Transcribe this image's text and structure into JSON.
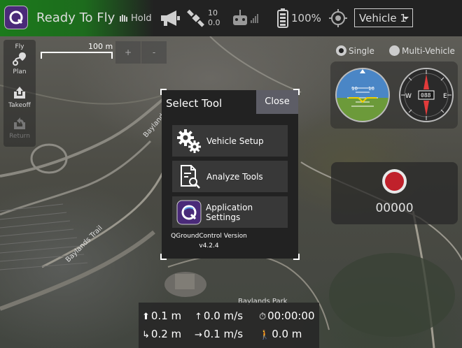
{
  "toolbar": {
    "status": "Ready To Fly",
    "flight_mode": "Hold",
    "satellite_count": "10",
    "satellite_hdop": "0.0",
    "battery": "100%",
    "vehicle_select": "Vehicle 1",
    "status_color": "#1d7a1d"
  },
  "toolstrip": {
    "fly": "Fly",
    "plan": "Plan",
    "takeoff": "Takeoff",
    "return": "Return"
  },
  "map": {
    "scale_label": "100 m",
    "zoom_in": "+",
    "zoom_out": "-",
    "labels": {
      "baylands_road": "Baylands",
      "baylands_trail": "Baylands Trail",
      "baylands_park": "Baylands Park"
    }
  },
  "vehicle_view": {
    "single": "Single",
    "multi": "Multi-Vehicle",
    "selected": "Single"
  },
  "instruments": {
    "attitude_ticks": [
      "10",
      "10"
    ],
    "compass_heading": "088",
    "compass_w": "W",
    "compass_e": "E"
  },
  "video": {
    "record_time": "00000",
    "record_color": "#c0212b"
  },
  "dialog": {
    "title": "Select Tool",
    "close": "Close",
    "buttons": [
      {
        "label": "Vehicle Setup",
        "icon": "gears-icon"
      },
      {
        "label": "Analyze Tools",
        "icon": "analyze-icon"
      },
      {
        "label": "Application Settings",
        "icon": "qgc-logo-icon"
      }
    ],
    "version_line1": "QGroundControl Version",
    "version_line2": "v4.2.4"
  },
  "telemetry": {
    "altitude_rel": "0.1 m",
    "vertical_speed": "0.0 m/s",
    "flight_time": "00:00:00",
    "distance_home": "0.2 m",
    "horizontal_speed": "0.1 m/s",
    "altitude_amsl": "0.0 m"
  }
}
